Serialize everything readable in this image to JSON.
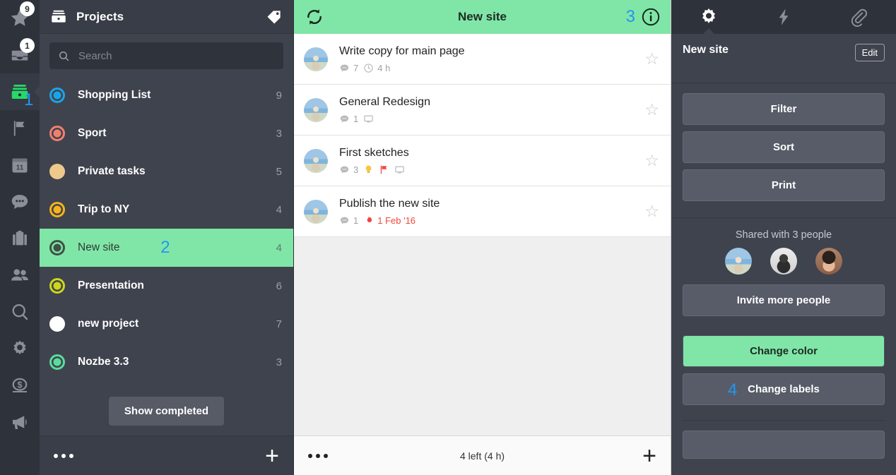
{
  "rail": {
    "items": [
      {
        "icon": "star-icon",
        "name": "rail-item-priority",
        "badge": "9"
      },
      {
        "icon": "inbox-icon",
        "name": "rail-item-inbox",
        "badge": "1"
      },
      {
        "icon": "projects-icon",
        "name": "rail-item-projects",
        "badge": "",
        "active": true
      },
      {
        "icon": "flag-icon",
        "name": "rail-item-flag",
        "badge": ""
      },
      {
        "icon": "calendar-11-icon",
        "name": "rail-item-calendar",
        "badge": "",
        "label": "11"
      },
      {
        "icon": "comments-icon",
        "name": "rail-item-comments",
        "badge": ""
      },
      {
        "icon": "briefcase-icon",
        "name": "rail-item-briefcase",
        "badge": ""
      },
      {
        "icon": "people-icon",
        "name": "rail-item-team",
        "badge": ""
      },
      {
        "icon": "search-icon",
        "name": "rail-item-search",
        "badge": ""
      },
      {
        "icon": "gear-icon",
        "name": "rail-item-settings",
        "badge": ""
      },
      {
        "icon": "dollar-icon",
        "name": "rail-item-billing",
        "badge": ""
      },
      {
        "icon": "megaphone-icon",
        "name": "rail-item-news",
        "badge": ""
      }
    ]
  },
  "annotations": {
    "one": "1",
    "two": "2",
    "three": "3",
    "four": "4",
    "color": "#2196f3"
  },
  "projects": {
    "header_title": "Projects",
    "header_icon": "projects-box-icon",
    "tag_icon": "tag-icon",
    "search_placeholder": "Search",
    "search_value": "",
    "items": [
      {
        "name": "Shopping List",
        "count": "9",
        "color": "#1aa4e8",
        "style": "ring",
        "selected": false
      },
      {
        "name": "Sport",
        "count": "3",
        "color": "#f0806e",
        "style": "ring",
        "selected": false
      },
      {
        "name": "Private tasks",
        "count": "5",
        "color": "#edc98c",
        "style": "solid",
        "selected": false
      },
      {
        "name": "Trip to NY",
        "count": "4",
        "color": "#f5b31b",
        "style": "ring",
        "selected": false
      },
      {
        "name": "New site",
        "count": "4",
        "color": "#3d5246",
        "style": "ring",
        "selected": true
      },
      {
        "name": "Presentation",
        "count": "6",
        "color": "#ccd61b",
        "style": "ring",
        "selected": false
      },
      {
        "name": "new project",
        "count": "7",
        "color": "#ffffff",
        "style": "solid",
        "selected": false
      },
      {
        "name": "Nozbe 3.3",
        "count": "3",
        "color": "#5bdc9b",
        "style": "ring",
        "selected": false
      }
    ],
    "show_completed_label": "Show completed",
    "footer": {
      "more_icon": "ellipsis-icon",
      "add_icon": "plus-icon"
    }
  },
  "tasks": {
    "header": {
      "title": "New site",
      "refresh_icon": "refresh-icon",
      "info_icon": "info-circle-icon",
      "bg_color": "#80e6a7"
    },
    "rows": [
      {
        "title": "Write copy for main page",
        "avatar": "cyclist",
        "star_icon": "star-outline-icon",
        "meta": [
          {
            "icon": "comment-icon",
            "text": "7"
          },
          {
            "icon": "clock-icon",
            "text": "4 h"
          }
        ]
      },
      {
        "title": "General Redesign",
        "avatar": "cyclist",
        "star_icon": "star-outline-icon",
        "meta": [
          {
            "icon": "comment-icon",
            "text": "1"
          },
          {
            "icon": "monitor-icon",
            "text": ""
          }
        ]
      },
      {
        "title": "First sketches",
        "avatar": "cyclist",
        "star_icon": "star-outline-icon",
        "meta": [
          {
            "icon": "comment-icon",
            "text": "3"
          },
          {
            "icon": "bulb-icon",
            "text": ""
          },
          {
            "icon": "red-flag-icon",
            "text": ""
          },
          {
            "icon": "monitor-icon",
            "text": ""
          }
        ]
      },
      {
        "title": "Publish the new site",
        "avatar": "cyclist",
        "star_icon": "star-outline-icon",
        "meta": [
          {
            "icon": "comment-icon",
            "text": "1"
          },
          {
            "icon": "fire-icon",
            "text": "1 Feb '16",
            "overdue": true
          }
        ]
      }
    ],
    "footer": {
      "more_icon": "ellipsis-icon",
      "summary": "4 left (4 h)",
      "add_icon": "plus-icon"
    }
  },
  "detail": {
    "tabs": [
      {
        "icon": "gear-icon",
        "name": "tab-settings",
        "active": true
      },
      {
        "icon": "bolt-icon",
        "name": "tab-activity",
        "active": false
      },
      {
        "icon": "paperclip-icon",
        "name": "tab-attachments",
        "active": false
      }
    ],
    "title": "New site",
    "edit_label": "Edit",
    "actions": [
      {
        "label": "Filter",
        "name": "filter-button",
        "green": false
      },
      {
        "label": "Sort",
        "name": "sort-button",
        "green": false
      },
      {
        "label": "Print",
        "name": "print-button",
        "green": false
      }
    ],
    "shared_label": "Shared with 3 people",
    "people": [
      {
        "avatar": "cyclist",
        "name": "shared-avatar-1"
      },
      {
        "avatar": "beard",
        "name": "shared-avatar-2"
      },
      {
        "avatar": "glasses",
        "name": "shared-avatar-3"
      }
    ],
    "invite_label": "Invite more people",
    "change_color_label": "Change color",
    "change_labels_label": "Change labels",
    "accent_green": "#80e6a7"
  }
}
